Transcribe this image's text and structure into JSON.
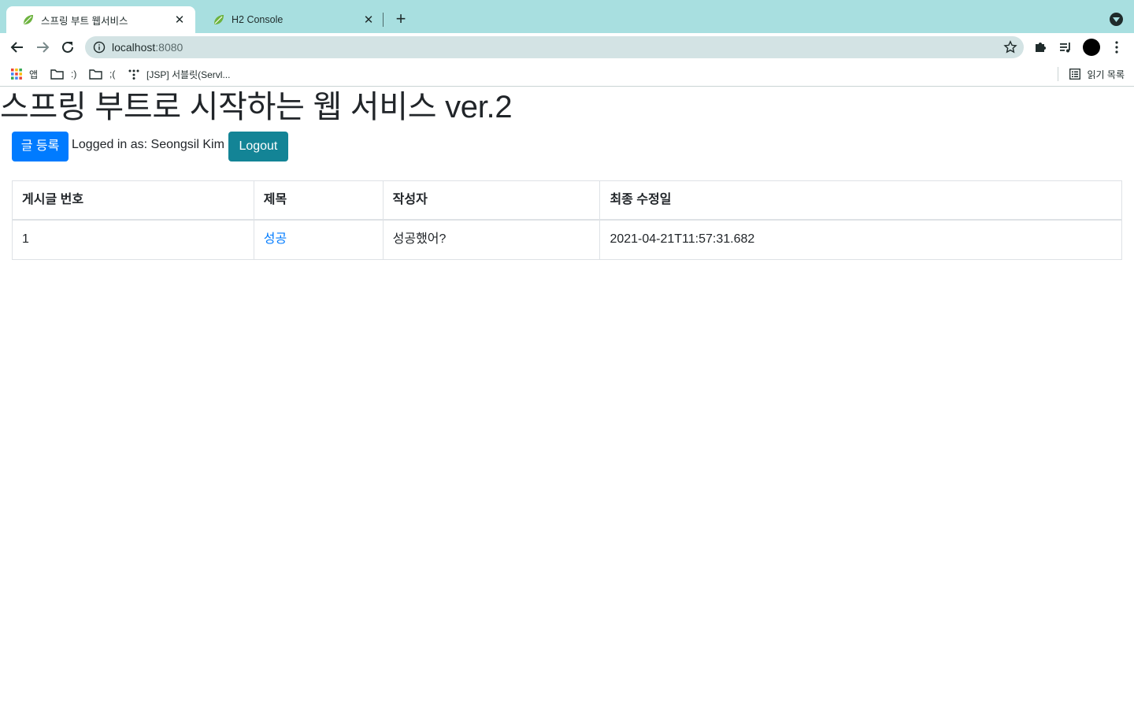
{
  "browser": {
    "tabs": [
      {
        "title": "스프링 부트 웹서비스",
        "active": true
      },
      {
        "title": "H2 Console",
        "active": false
      }
    ],
    "url": {
      "host": "localhost",
      "port": ":8080"
    },
    "bookmarks": [
      {
        "label": "앱",
        "icon": "apps-grid-icon"
      },
      {
        "label": ":)",
        "icon": "folder-icon"
      },
      {
        "label": ";(",
        "icon": "folder-icon"
      },
      {
        "label": "[JSP] 서블릿(Servl...",
        "icon": "dots-icon"
      }
    ],
    "reading_list": "읽기 목록",
    "colors": {
      "tabstrip": "#a8dfe0",
      "omnibox": "#d3e3e4"
    }
  },
  "page": {
    "title": "스프링 부트로 시작하는 웹 서비스 ver.2",
    "write_button": "글 등록",
    "logged_in_text": "Logged in as: Seongsil Kim",
    "logout_button": "Logout",
    "table": {
      "headers": [
        "게시글 번호",
        "제목",
        "작성자",
        "최종 수정일"
      ],
      "rows": [
        {
          "id": "1",
          "title": "성공",
          "author": "성공했어?",
          "modified": "2021-04-21T11:57:31.682"
        }
      ]
    },
    "colors": {
      "primary": "#007bff",
      "info": "#138496",
      "link": "#007bff"
    }
  }
}
